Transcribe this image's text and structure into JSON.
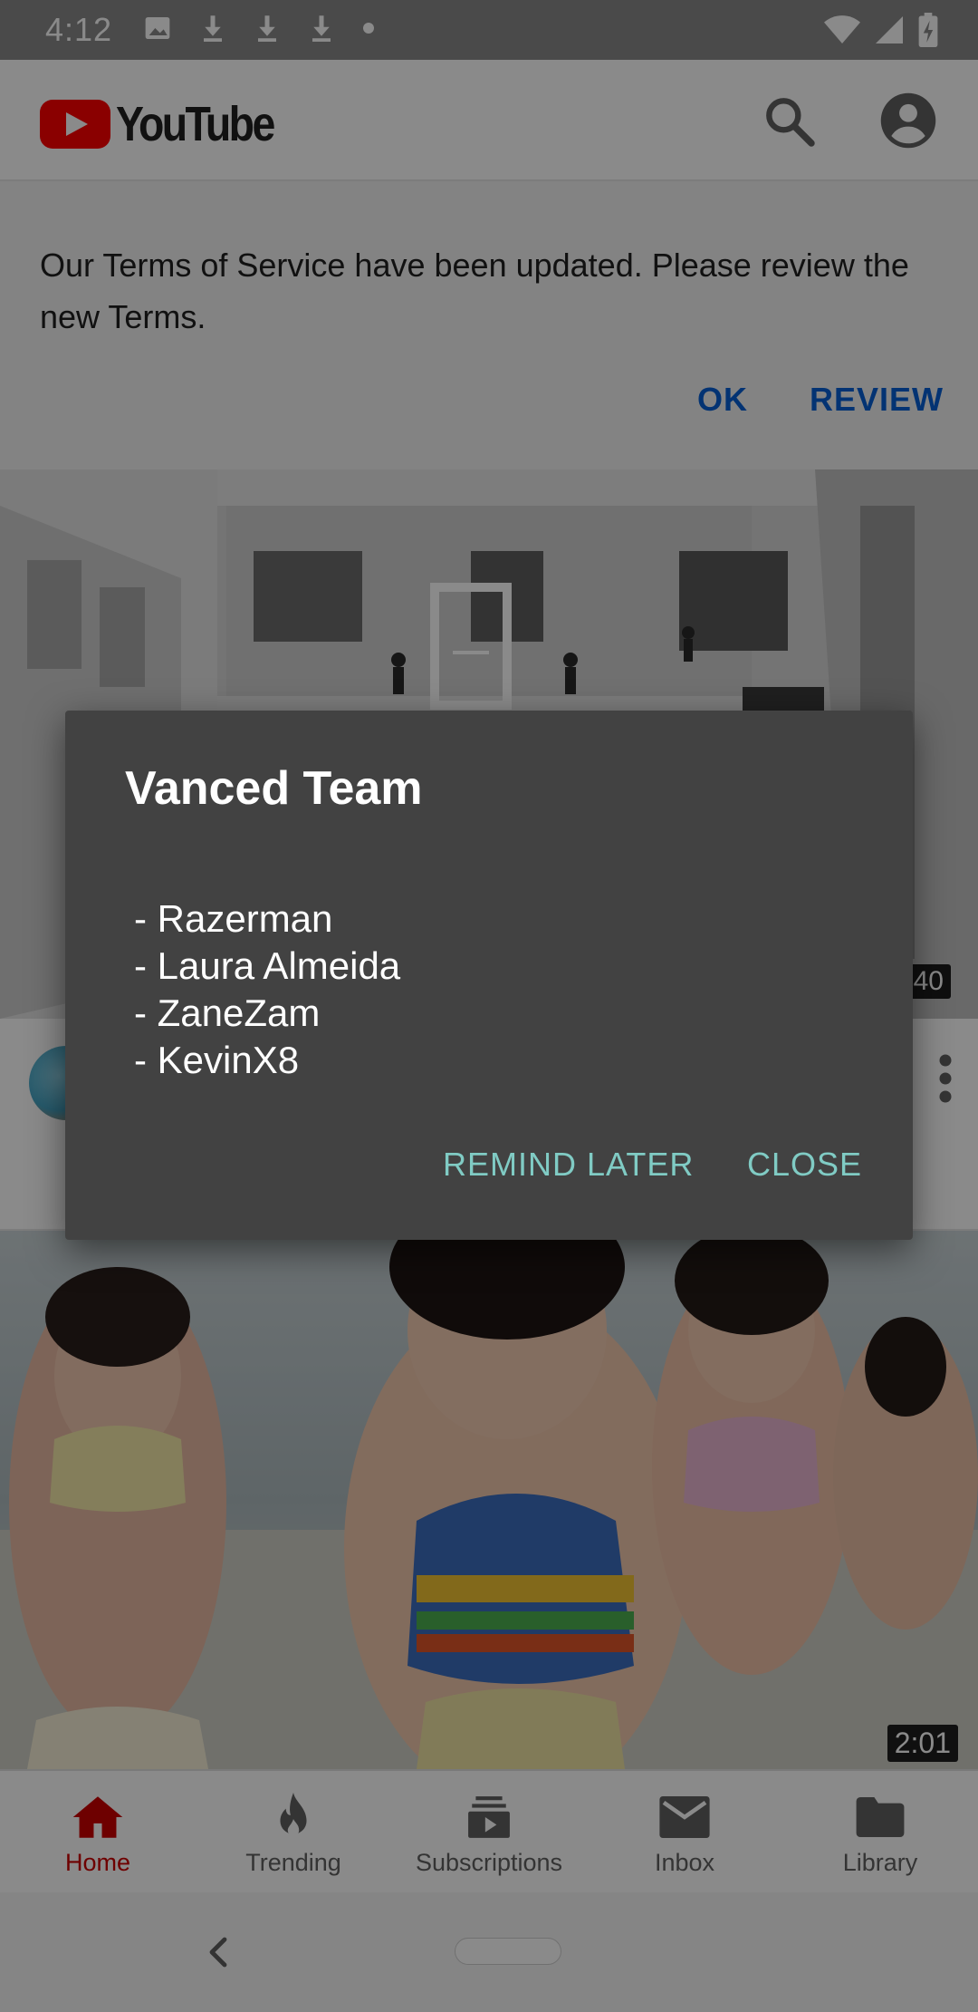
{
  "status_bar": {
    "time": "4:12",
    "left_icons": [
      "image-icon",
      "download-icon",
      "download-icon",
      "download-icon",
      "dot-icon"
    ],
    "right_icons": [
      "wifi-icon",
      "signal-icon",
      "battery-icon"
    ]
  },
  "app_bar": {
    "logo_text": "YouTube",
    "icons": [
      "search-icon",
      "account-icon"
    ]
  },
  "terms_banner": {
    "message": "Our Terms of Service have been updated. Please review the new Terms.",
    "ok_label": "OK",
    "review_label": "REVIEW"
  },
  "feed": {
    "video1": {
      "duration": "40"
    },
    "video2": {
      "duration": "2:01"
    }
  },
  "bottom_nav": {
    "items": [
      {
        "label": "Home",
        "icon": "home-icon",
        "active": true
      },
      {
        "label": "Trending",
        "icon": "trending-icon",
        "active": false
      },
      {
        "label": "Subscriptions",
        "icon": "subscriptions-icon",
        "active": false
      },
      {
        "label": "Inbox",
        "icon": "inbox-icon",
        "active": false
      },
      {
        "label": "Library",
        "icon": "library-icon",
        "active": false
      }
    ]
  },
  "dialog": {
    "title": "Vanced Team",
    "lines": [
      "- Razerman",
      "- Laura Almeida",
      "- ZaneZam",
      "- KevinX8"
    ],
    "remind_label": "REMIND LATER",
    "close_label": "CLOSE"
  },
  "colors": {
    "accent_dialog_button": "#80cbc4",
    "youtube_red": "#ff0000",
    "link_blue": "#065fd4",
    "dialog_bg": "#424242"
  }
}
